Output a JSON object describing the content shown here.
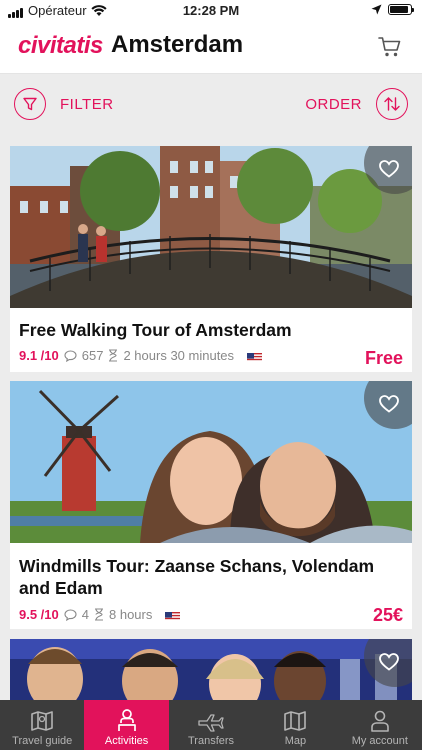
{
  "status_bar": {
    "carrier": "Opérateur",
    "time": "12:28 PM",
    "battery_level": 0.9
  },
  "header": {
    "brand": "civitatis",
    "city": "Amsterdam"
  },
  "toolbar": {
    "filter_label": "FILTER",
    "order_label": "ORDER"
  },
  "activities": [
    {
      "title": "Free Walking Tour of Amsterdam",
      "rating": "9.1 /10",
      "reviews": "657",
      "duration": "2 hours 30 minutes",
      "price": "Free"
    },
    {
      "title": "Windmills Tour: Zaanse Schans, Volendam and Edam",
      "rating": "9.5 /10",
      "reviews": "4",
      "duration": "8 hours",
      "price": "25€"
    }
  ],
  "tabs": [
    {
      "label": "Travel guide",
      "icon": "map-book-icon"
    },
    {
      "label": "Activities",
      "icon": "person-icon",
      "active": true
    },
    {
      "label": "Transfers",
      "icon": "plane-icon"
    },
    {
      "label": "Map",
      "icon": "map-icon"
    },
    {
      "label": "My account",
      "icon": "account-icon"
    }
  ],
  "colors": {
    "accent": "#e2125b",
    "tab_bar": "#3c3c3c"
  }
}
